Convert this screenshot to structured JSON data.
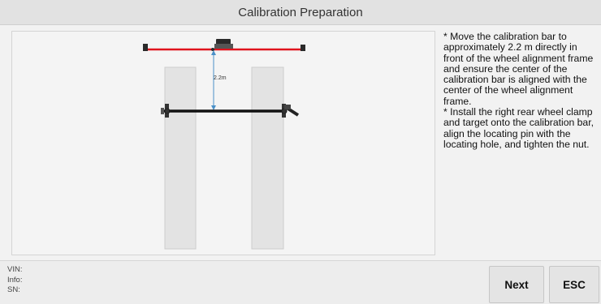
{
  "header": {
    "title": "Calibration Preparation"
  },
  "diagram": {
    "distance_label": "2.2m"
  },
  "instructions": {
    "step1": "* Move the calibration bar to approximately 2.2 m directly in front of the wheel alignment frame and ensure the center of the calibration bar is aligned with the center of the wheel alignment frame.",
    "step2": "* Install the right rear wheel clamp and target onto the calibration bar, align the locating pin with the locating hole, and tighten the nut."
  },
  "vehicle_info": {
    "vin_label": "VIN:",
    "info_label": "Info:",
    "sn_label": "SN:"
  },
  "buttons": {
    "next_label": "Next",
    "esc_label": "ESC"
  },
  "colors": {
    "frame_bar": "#e0141e",
    "calibration_bar": "#111111",
    "dimension_line": "#4a90c8"
  }
}
